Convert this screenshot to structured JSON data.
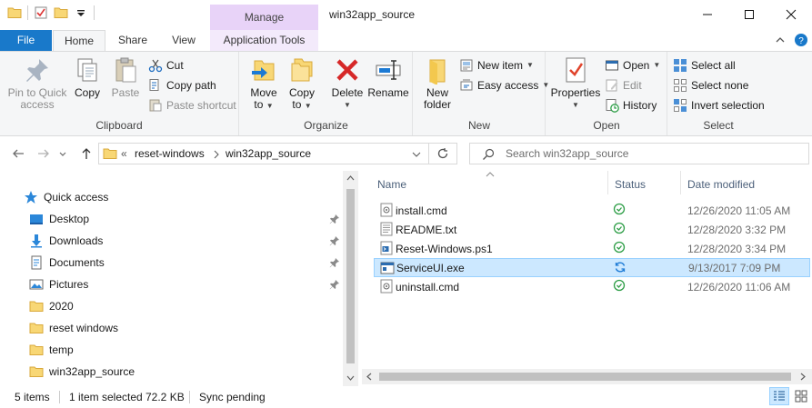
{
  "titlebar": {
    "title": "win32app_source",
    "manage_label": "Manage",
    "controls": [
      "minimize",
      "maximize",
      "close"
    ]
  },
  "ribbon_tabs": {
    "file": "File",
    "home": "Home",
    "share": "Share",
    "view": "View",
    "app_tools": "Application Tools"
  },
  "clipboard": {
    "group_label": "Clipboard",
    "pin_label_1": "Pin to Quick",
    "pin_label_2": "access",
    "copy": "Copy",
    "paste": "Paste",
    "cut": "Cut",
    "copy_path": "Copy path",
    "paste_shortcut": "Paste shortcut"
  },
  "organize": {
    "group_label": "Organize",
    "move_to": "Move",
    "move_to_2": "to",
    "copy_to": "Copy",
    "copy_to_2": "to",
    "delete": "Delete",
    "rename": "Rename"
  },
  "new": {
    "group_label": "New",
    "new_folder_1": "New",
    "new_folder_2": "folder",
    "new_item": "New item",
    "easy_access": "Easy access"
  },
  "open": {
    "group_label": "Open",
    "properties": "Properties",
    "open": "Open",
    "edit": "Edit",
    "history": "History"
  },
  "select": {
    "group_label": "Select",
    "select_all": "Select all",
    "select_none": "Select none",
    "invert_selection": "Invert selection"
  },
  "address": {
    "overflow": "«",
    "crumb_1": "reset-windows",
    "crumb_2": "win32app_source",
    "search_placeholder": "Search win32app_source"
  },
  "nav_pane": {
    "quick_access": "Quick access",
    "items": [
      {
        "label": "Desktop",
        "pinned": true
      },
      {
        "label": "Downloads",
        "pinned": true
      },
      {
        "label": "Documents",
        "pinned": true
      },
      {
        "label": "Pictures",
        "pinned": true
      },
      {
        "label": "2020",
        "pinned": false
      },
      {
        "label": "reset windows",
        "pinned": false
      },
      {
        "label": "temp",
        "pinned": false
      },
      {
        "label": "win32app_source",
        "pinned": false
      }
    ]
  },
  "file_list": {
    "columns": {
      "name": "Name",
      "status": "Status",
      "date": "Date modified"
    },
    "files": [
      {
        "name": "install.cmd",
        "status": "synced",
        "date": "12/26/2020 11:05 AM"
      },
      {
        "name": "README.txt",
        "status": "synced",
        "date": "12/28/2020 3:32 PM"
      },
      {
        "name": "Reset-Windows.ps1",
        "status": "synced",
        "date": "12/28/2020 3:34 PM"
      },
      {
        "name": "ServiceUI.exe",
        "status": "sync-pending",
        "date": "9/13/2017 7:09 PM"
      },
      {
        "name": "uninstall.cmd",
        "status": "synced",
        "date": "12/26/2020 11:06 AM"
      }
    ]
  },
  "status_bar": {
    "item_count": "5 items",
    "selection": "1 item selected",
    "size": "72.2 KB",
    "sync": "Sync pending"
  },
  "colors": {
    "accent": "#1979ca",
    "manage_tab": "#e8d3f8",
    "selection": "#cce8ff",
    "status_ok": "#2e9e47",
    "status_pending": "#1e7bd6",
    "folder": "#f8d775"
  }
}
